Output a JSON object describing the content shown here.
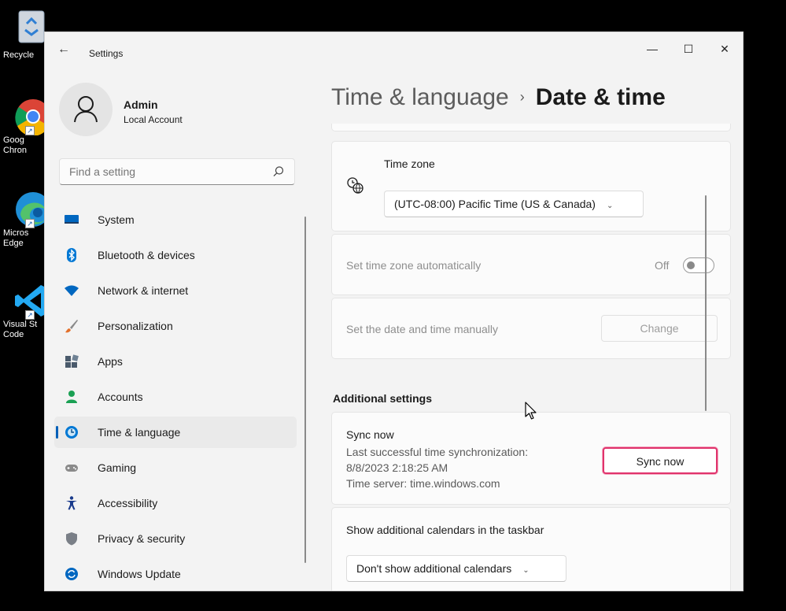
{
  "desktop": {
    "icons": [
      {
        "label": "Recycle"
      },
      {
        "label": "Goog Chron"
      },
      {
        "label": "Micros Edge"
      },
      {
        "label": "Visual St Code"
      }
    ]
  },
  "window": {
    "title": "Settings",
    "controls": {
      "minimize": "—",
      "maximize": "☐",
      "close": "✕"
    }
  },
  "profile": {
    "name": "Admin",
    "account_type": "Local Account"
  },
  "search": {
    "placeholder": "Find a setting"
  },
  "nav": {
    "items": [
      {
        "label": "System",
        "icon": "monitor-icon",
        "color": "#0067c0"
      },
      {
        "label": "Bluetooth & devices",
        "icon": "bluetooth-icon",
        "color": "#0078d4"
      },
      {
        "label": "Network & internet",
        "icon": "wifi-icon",
        "color": "#0067c0"
      },
      {
        "label": "Personalization",
        "icon": "brush-icon",
        "color": "#e3702a"
      },
      {
        "label": "Apps",
        "icon": "apps-icon",
        "color": "#4a5a6b"
      },
      {
        "label": "Accounts",
        "icon": "person-icon",
        "color": "#1aa053"
      },
      {
        "label": "Time & language",
        "icon": "clock-globe-icon",
        "color": "#0078d4"
      },
      {
        "label": "Gaming",
        "icon": "gamepad-icon",
        "color": "#7a7a7a"
      },
      {
        "label": "Accessibility",
        "icon": "accessibility-icon",
        "color": "#1a3b8c"
      },
      {
        "label": "Privacy & security",
        "icon": "shield-icon",
        "color": "#7a7f87"
      },
      {
        "label": "Windows Update",
        "icon": "update-icon",
        "color": "#0067c0"
      }
    ],
    "selected": "Time & language"
  },
  "header": {
    "parent": "Time & language",
    "separator": "›",
    "current": "Date & time"
  },
  "timezone": {
    "label": "Time zone",
    "value": "(UTC-08:00) Pacific Time (US & Canada)"
  },
  "auto_timezone": {
    "label": "Set time zone automatically",
    "state": "Off"
  },
  "manual_time": {
    "label": "Set the date and time manually",
    "button": "Change"
  },
  "additional": {
    "section_title": "Additional settings",
    "sync": {
      "title": "Sync now",
      "line1": "Last successful time synchronization:",
      "line2": "8/8/2023 2:18:25 AM",
      "line3": "Time server: time.windows.com",
      "button": "Sync now"
    },
    "calendars": {
      "label": "Show additional calendars in the taskbar",
      "value": "Don't show additional calendars"
    }
  }
}
